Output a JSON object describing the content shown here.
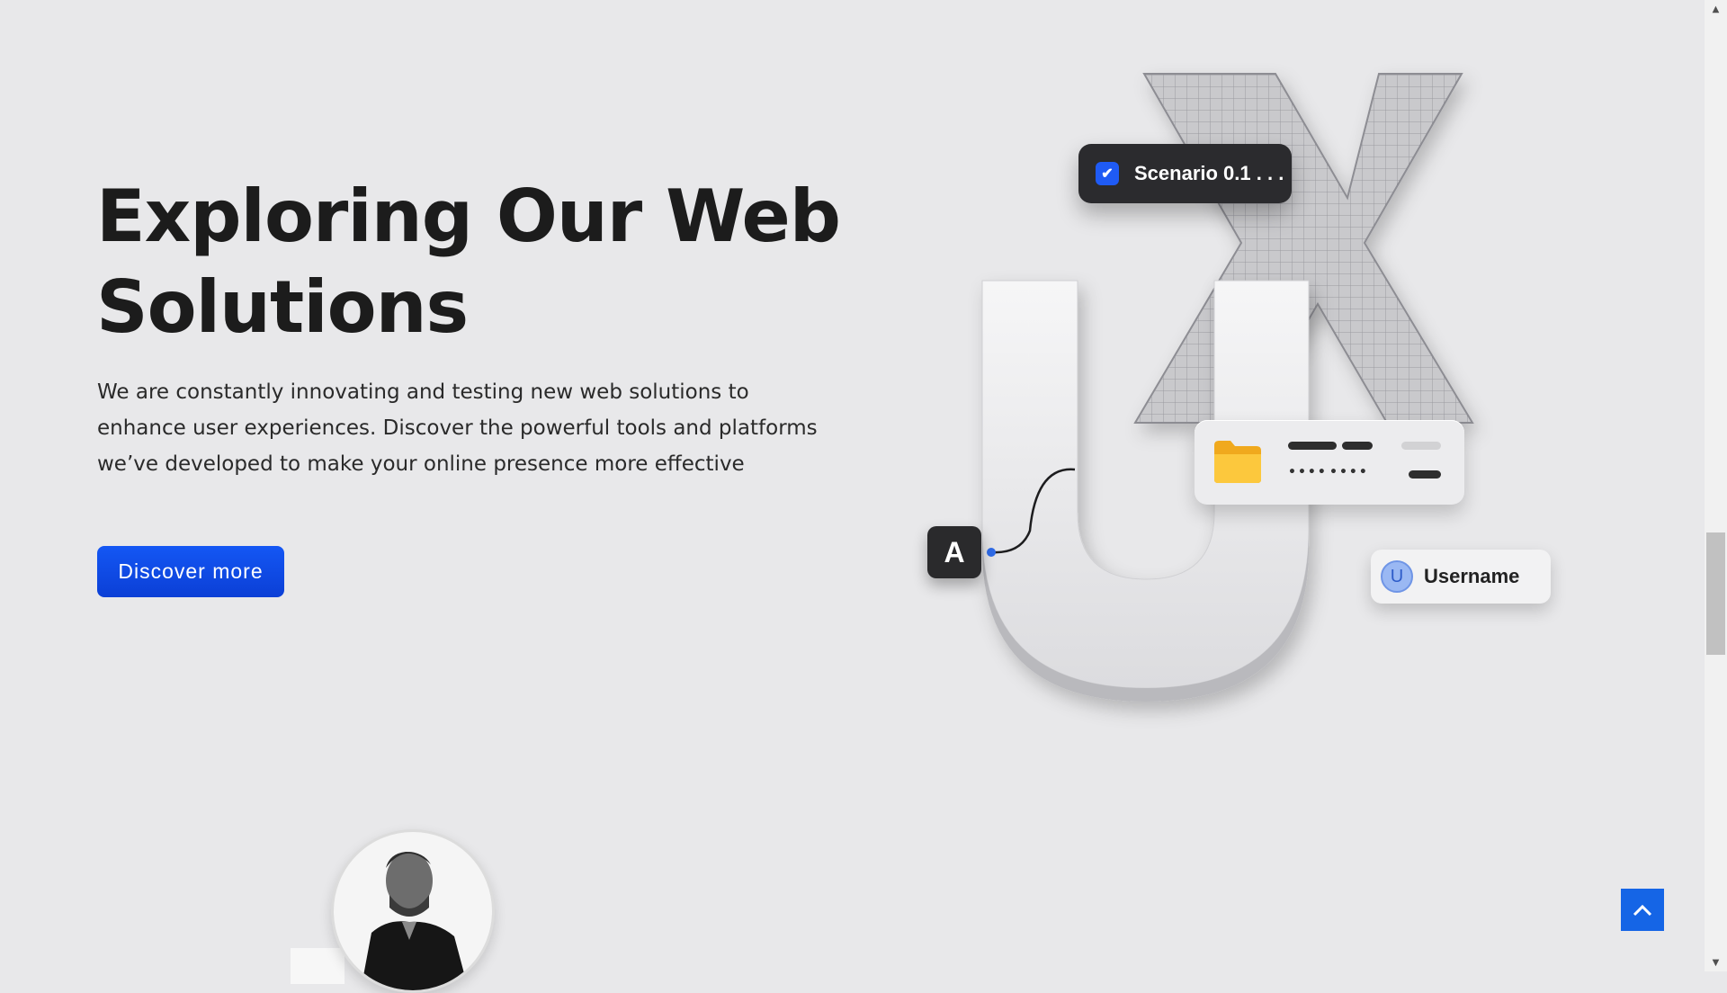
{
  "hero": {
    "title_line1": "Exploring Our Web",
    "title_line2": "Solutions",
    "description": "We are constantly innovating and testing new web solutions to enhance user experiences. Discover the powerful tools and platforms we’ve developed to make your online presence more effective",
    "cta_label": "Discover  more"
  },
  "illustration": {
    "scenario_label": "Scenario 0.1 . . .",
    "user_initial": "U",
    "username_label": "Username",
    "key_letter": "A",
    "folder_dots_1": "••••",
    "folder_dots_2": "••••"
  },
  "icons": {
    "check": "check-icon",
    "folder": "folder-icon",
    "back_to_top": "chevron-up-icon",
    "scroll_up": "triangle-up-icon",
    "scroll_down": "triangle-down-icon"
  },
  "colors": {
    "background": "#e8e8ea",
    "accent": "#0b47e6",
    "back_to_top": "#1565e6"
  }
}
